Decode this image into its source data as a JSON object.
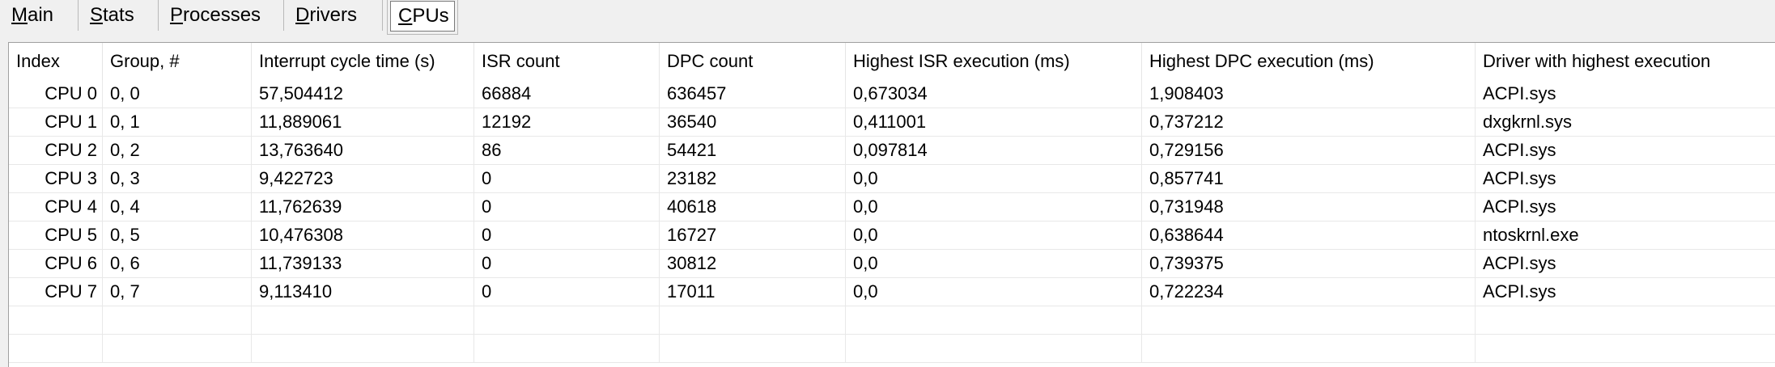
{
  "tabs": [
    {
      "label": "Main",
      "ul": "M",
      "rest": "ain"
    },
    {
      "label": "Stats",
      "ul": "S",
      "rest": "tats"
    },
    {
      "label": "Processes",
      "ul": "P",
      "rest": "rocesses"
    },
    {
      "label": "Drivers",
      "ul": "D",
      "rest": "rivers"
    },
    {
      "label": "CPUs",
      "ul": "C",
      "rest": "PUs"
    }
  ],
  "active_tab": "CPUs",
  "columns": [
    "Index",
    "Group, #",
    "Interrupt cycle time (s)",
    "ISR count",
    "DPC count",
    "Highest ISR execution (ms)",
    "Highest DPC execution (ms)",
    "Driver with highest execution"
  ],
  "rows": [
    [
      "CPU 0",
      "0, 0",
      "57,504412",
      "66884",
      "636457",
      "0,673034",
      "1,908403",
      "ACPI.sys"
    ],
    [
      "CPU 1",
      "0, 1",
      "11,889061",
      "12192",
      "36540",
      "0,411001",
      "0,737212",
      "dxgkrnl.sys"
    ],
    [
      "CPU 2",
      "0, 2",
      "13,763640",
      "86",
      "54421",
      "0,097814",
      "0,729156",
      "ACPI.sys"
    ],
    [
      "CPU 3",
      "0, 3",
      "9,422723",
      "0",
      "23182",
      "0,0",
      "0,857741",
      "ACPI.sys"
    ],
    [
      "CPU 4",
      "0, 4",
      "11,762639",
      "0",
      "40618",
      "0,0",
      "0,731948",
      "ACPI.sys"
    ],
    [
      "CPU 5",
      "0, 5",
      "10,476308",
      "0",
      "16727",
      "0,0",
      "0,638644",
      "ntoskrnl.exe"
    ],
    [
      "CPU 6",
      "0, 6",
      "11,739133",
      "0",
      "30812",
      "0,0",
      "0,739375",
      "ACPI.sys"
    ],
    [
      "CPU 7",
      "0, 7",
      "9,113410",
      "0",
      "17011",
      "0,0",
      "0,722234",
      "ACPI.sys"
    ],
    [
      "",
      "",
      "",
      "",
      "",
      "",
      "",
      ""
    ],
    [
      "",
      "",
      "",
      "",
      "",
      "",
      "",
      ""
    ]
  ]
}
